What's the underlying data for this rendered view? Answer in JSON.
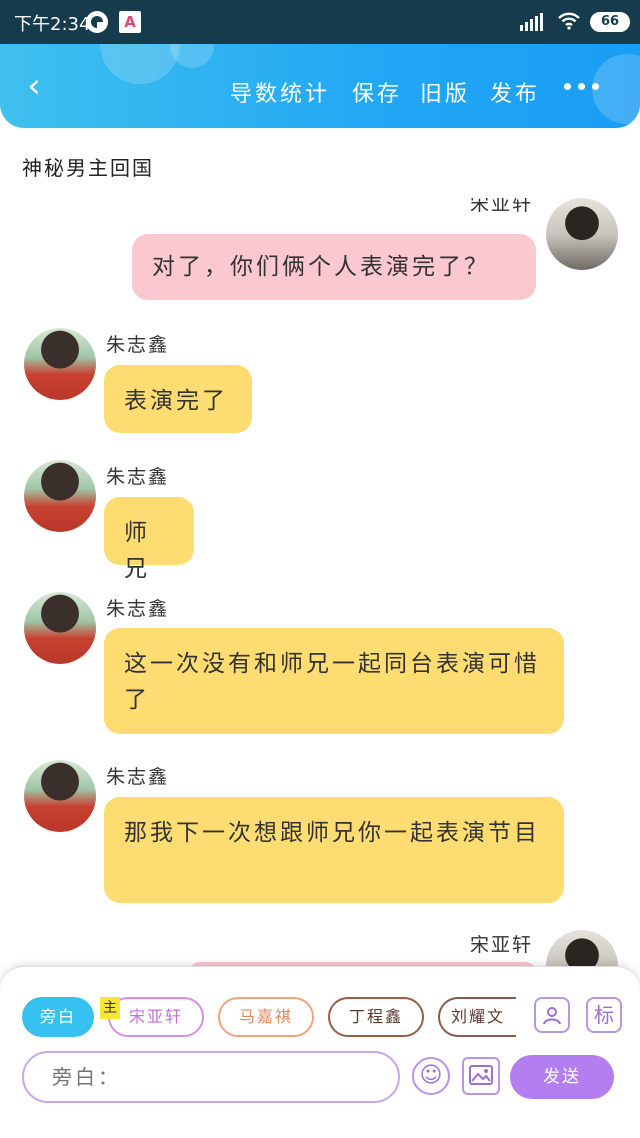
{
  "status_bar": {
    "time": "下午2:34",
    "app_icon_2": "A",
    "wifi_icon": "wifi-icon",
    "battery": "66"
  },
  "header": {
    "back_icon": "‹",
    "actions": [
      "导数统计",
      "保存",
      "旧版",
      "发布"
    ]
  },
  "story": {
    "title": "神秘男主回国"
  },
  "messages": [
    {
      "side": "right",
      "speaker": "宋亚轩",
      "text": "对了，你们俩个人表演完了？",
      "color": "pink"
    },
    {
      "side": "left",
      "speaker": "朱志鑫",
      "text": "表演完了",
      "color": "yellow"
    },
    {
      "side": "left",
      "speaker": "朱志鑫",
      "text": "师兄",
      "color": "yellow"
    },
    {
      "side": "left",
      "speaker": "朱志鑫",
      "text": "这一次没有和师兄一起同台表演可惜了",
      "color": "yellow"
    },
    {
      "side": "left",
      "speaker": "朱志鑫",
      "text": "那我下一次想跟师兄你一起表演节目",
      "color": "yellow"
    },
    {
      "side": "right",
      "speaker": "宋亚轩",
      "text": "",
      "color": "pink"
    }
  ],
  "composer": {
    "roles": [
      "旁白",
      "宋亚轩",
      "马嘉祺",
      "丁程鑫",
      "刘耀文"
    ],
    "main_badge": "主",
    "mark_label": "标",
    "input_placeholder": "旁白：",
    "send_label": "发送",
    "colors": {
      "narrator": "#37c1f0",
      "songyaxuan": "#d78ee6",
      "majiaqi": "#f0a47d",
      "dingchengxin": "#9a5c4a",
      "liuyaowen": "#8a5b4c",
      "send": "#b37ff0"
    }
  }
}
